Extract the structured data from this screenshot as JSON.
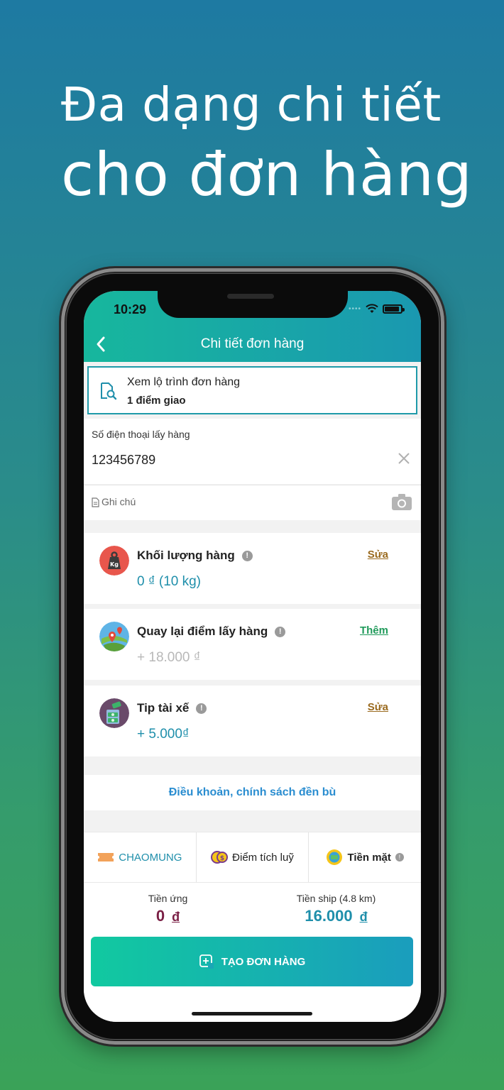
{
  "headline": {
    "line1": "Đa dạng chi tiết",
    "line2": "cho đơn hàng"
  },
  "status_bar": {
    "time": "10:29",
    "signal": "••••"
  },
  "appbar": {
    "title": "Chi tiết đơn hàng"
  },
  "route": {
    "title": "Xem lộ trình đơn hàng",
    "subtitle": "1 điểm giao"
  },
  "pickup_phone": {
    "label": "Số điện thoại lấy hàng",
    "value": "123456789"
  },
  "note": {
    "label": "Ghi chú"
  },
  "services": [
    {
      "title": "Khối lượng hàng",
      "value": "0 ₫ (10 kg)",
      "action": "Sửa",
      "value_color": "#1f8fab",
      "action_color": "#9a6a1e",
      "icon": "weight-icon"
    },
    {
      "title": "Quay lại điểm lấy hàng",
      "value": "+ 18.000 ₫",
      "action": "Thêm",
      "value_color": "#b8b8b8",
      "action_color": "#1f9a5a",
      "icon": "return-map-icon"
    },
    {
      "title": "Tip tài xế",
      "value": "+ 5.000₫",
      "action": "Sửa",
      "value_color": "#1f8fab",
      "action_color": "#9a6a1e",
      "icon": "tip-money-icon"
    }
  ],
  "policy_link": "Điều khoản, chính sách đền bù",
  "payment": {
    "promo_badge": "%",
    "promo": "CHAOMUNG",
    "points": "Điểm tích luỹ",
    "method": "Tiền mặt"
  },
  "totals": {
    "advance_label": "Tiền ứng",
    "advance_value": "0",
    "ship_label": "Tiền ship (4.8 km)",
    "ship_value": "16.000",
    "currency": "đ"
  },
  "create_button": "TẠO ĐƠN HÀNG",
  "colors": {
    "teal": "#17b79d",
    "blue": "#1a98b0",
    "advance": "#7a1f45",
    "ship": "#1f8fab"
  }
}
